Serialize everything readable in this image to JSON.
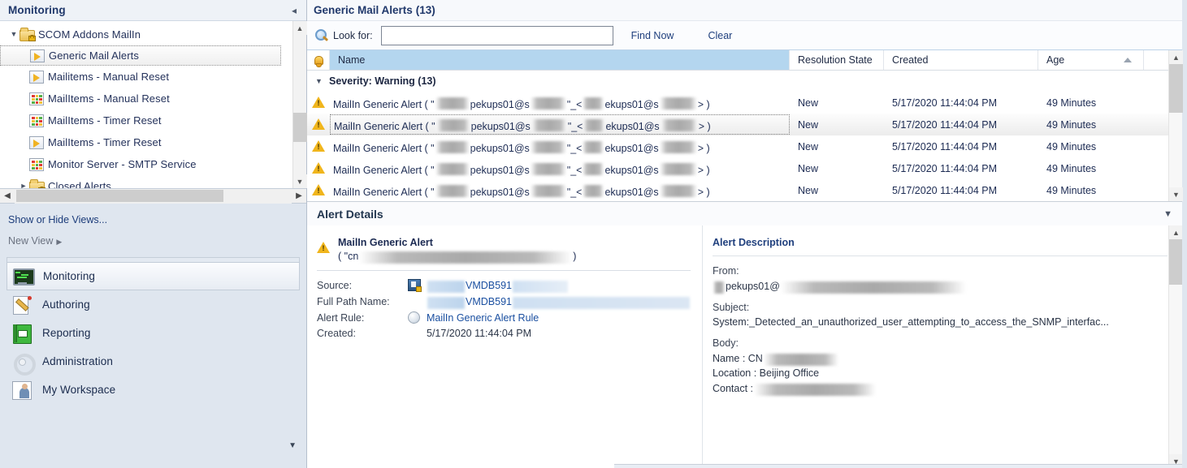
{
  "left_panel": {
    "title": "Monitoring",
    "collapse_icon": "chevron-left-icon",
    "tree": [
      {
        "label": "SCOM Addons MailIn",
        "level": 1,
        "twisty": "expanded",
        "icon": "folder-locked-icon",
        "selected": false
      },
      {
        "label": "Generic Mail Alerts",
        "level": 2,
        "twisty": "",
        "icon": "alert-view-icon",
        "selected": true
      },
      {
        "label": "Mailitems - Manual Reset",
        "level": 2,
        "twisty": "",
        "icon": "alert-view-icon",
        "selected": false
      },
      {
        "label": "MailItems - Manual Reset",
        "level": 2,
        "twisty": "",
        "icon": "state-view-icon",
        "selected": false
      },
      {
        "label": "MailItems - Timer Reset",
        "level": 2,
        "twisty": "",
        "icon": "state-view-icon",
        "selected": false
      },
      {
        "label": "MailItems - Timer Reset",
        "level": 2,
        "twisty": "",
        "icon": "alert-view-icon",
        "selected": false
      },
      {
        "label": "Monitor Server - SMTP Service",
        "level": 2,
        "twisty": "",
        "icon": "state-view-icon",
        "selected": false
      },
      {
        "label": "Closed Alerts",
        "level": 1,
        "twisty": "collapsed",
        "icon": "folder-locked-icon",
        "selected": false
      }
    ],
    "links": [
      {
        "label": "Show or Hide Views...",
        "muted": false,
        "arrow": false
      },
      {
        "label": "New View",
        "muted": true,
        "arrow": true
      }
    ],
    "nav": [
      {
        "label": "Monitoring",
        "icon": "monitoring-icon",
        "active": true
      },
      {
        "label": "Authoring",
        "icon": "authoring-icon",
        "active": false
      },
      {
        "label": "Reporting",
        "icon": "reporting-icon",
        "active": false
      },
      {
        "label": "Administration",
        "icon": "administration-icon",
        "active": false
      },
      {
        "label": "My Workspace",
        "icon": "my-workspace-icon",
        "active": false
      }
    ],
    "overflow_icon": "chevron-down-icon"
  },
  "main": {
    "header": {
      "title": "Generic Mail Alerts",
      "count": "(13)"
    },
    "search": {
      "icon": "search-icon",
      "label": "Look for:",
      "value": "",
      "placeholder": "",
      "find_now": "Find Now",
      "clear": "Clear"
    },
    "columns": {
      "icon": "bell-icon",
      "name": "Name",
      "resolution_state": "Resolution State",
      "created": "Created",
      "age": "Age",
      "sort_indicator": "sort-ascending-icon"
    },
    "group": {
      "twisty": "expanded",
      "label": "Severity: Warning (13)"
    },
    "rows": [
      {
        "severity_icon": "warning-icon",
        "name_prefix": "MailIn Generic Alert ( \"",
        "name_mid1": "pekups01@s",
        "name_mid2": "\"_<",
        "name_mid3": "ekups01@s",
        "name_suffix": "> )",
        "resolution_state": "New",
        "created": "5/17/2020 11:44:04 PM",
        "age": "49 Minutes",
        "selected": false
      },
      {
        "severity_icon": "warning-icon",
        "name_prefix": "MailIn Generic Alert ( \"",
        "name_mid1": "pekups01@s",
        "name_mid2": "\"_<",
        "name_mid3": "ekups01@s",
        "name_suffix": "> )",
        "resolution_state": "New",
        "created": "5/17/2020 11:44:04 PM",
        "age": "49 Minutes",
        "selected": true
      },
      {
        "severity_icon": "warning-icon",
        "name_prefix": "MailIn Generic Alert ( \"",
        "name_mid1": "pekups01@s",
        "name_mid2": "\"_<",
        "name_mid3": "ekups01@s",
        "name_suffix": "> )",
        "resolution_state": "New",
        "created": "5/17/2020 11:44:04 PM",
        "age": "49 Minutes",
        "selected": false
      },
      {
        "severity_icon": "warning-icon",
        "name_prefix": "MailIn Generic Alert ( \"",
        "name_mid1": "pekups01@s",
        "name_mid2": "\"_<",
        "name_mid3": "ekups01@s",
        "name_suffix": "> )",
        "resolution_state": "New",
        "created": "5/17/2020 11:44:04 PM",
        "age": "49 Minutes",
        "selected": false
      },
      {
        "severity_icon": "warning-icon",
        "name_prefix": "MailIn Generic Alert ( \"",
        "name_mid1": "pekups01@s",
        "name_mid2": "\"_<",
        "name_mid3": "ekups01@s",
        "name_suffix": "> )",
        "resolution_state": "New",
        "created": "5/17/2020 11:44:04 PM",
        "age": "49 Minutes",
        "selected": false
      }
    ]
  },
  "details": {
    "title": "Alert Details",
    "collapse_icon": "chevron-down-icon",
    "alert": {
      "severity_icon": "warning-icon",
      "title": "MailIn Generic Alert",
      "subtitle_prefix": "( \"cn",
      "subtitle_suffix": ")"
    },
    "fields": [
      {
        "key": "Source:",
        "value": "VMDB591",
        "icon": "server-locked-icon",
        "style": "redacted-link"
      },
      {
        "key": "Full Path Name:",
        "value": "VMDB591",
        "icon": "",
        "style": "redacted-link"
      },
      {
        "key": "Alert Rule:",
        "value": "MailIn Generic Alert Rule",
        "icon": "rule-icon",
        "style": "link"
      },
      {
        "key": "Created:",
        "value": "5/17/2020 11:44:04 PM",
        "icon": "",
        "style": "plain"
      }
    ],
    "description": {
      "title": "Alert Description",
      "from_label": "From:",
      "from_value": "pekups01@",
      "subject_label": "Subject:",
      "subject_value": "System:_Detected_an_unauthorized_user_attempting_to_access_the_SNMP_interfac...",
      "body_label": "Body:",
      "body_lines": [
        {
          "label": "Name : CN",
          "redacted": true
        },
        {
          "label": "Location : Beijing Office",
          "redacted": false
        },
        {
          "label": "Contact : ",
          "redacted": true
        }
      ]
    }
  },
  "colors": {
    "accent_blue": "#20386b",
    "link_blue": "#1f3f7d",
    "header_highlight": "#b4d6ef",
    "warning_yellow": "#f0b51c",
    "panel_bg": "#dfe6ef"
  }
}
